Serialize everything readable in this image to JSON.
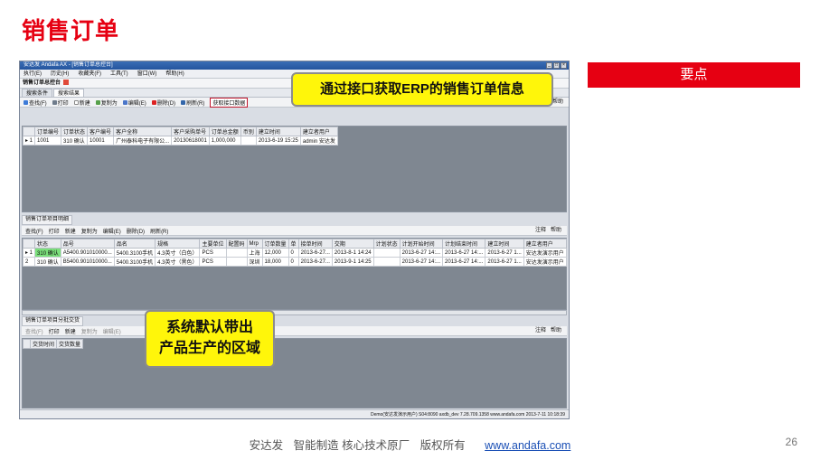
{
  "slide": {
    "title": "销售订单",
    "keypoint": "要点",
    "callout_top": "通过接口获取ERP的销售订单信息",
    "callout_bottom_line1": "系统默认带出",
    "callout_bottom_line2": "产品生产的区域",
    "footer": {
      "company": "安达发",
      "slogan": "智能制造 核心技术原厂",
      "rights": "版权所有",
      "url": "www.andafa.com"
    },
    "page_number": "26"
  },
  "app": {
    "window_title": "安达发 Andafa AX - [销售订单总控台]",
    "menu": [
      "执行(E)",
      "历史(H)",
      "收藏夹(F)",
      "工具(T)",
      "窗口(W)",
      "帮助(H)"
    ],
    "form_tab": "销售订单总控台",
    "subtabs": [
      "搜索条件",
      "搜索结果"
    ],
    "toolbar_top": [
      "查找(F)",
      "打印",
      "新建",
      "复制为",
      "编辑(E)",
      "删除(D)",
      "刷新(R)",
      "获取接口数据"
    ],
    "toolbar_right": [
      "注释",
      "帮助"
    ],
    "orders": {
      "columns": [
        "订单编号",
        "订单状态",
        "客户编号",
        "客户全称",
        "客户采购单号",
        "订单总金额",
        "币别",
        "建立时间",
        "建立者用户"
      ],
      "rows": [
        [
          "1001",
          "310 确认",
          "10001",
          "广州泰科电子有限公...",
          "20130618001",
          "1,000,000",
          "",
          "2013-6-19 15:25",
          "admin 安达发"
        ]
      ]
    },
    "detail_label": "销售订单项目明细",
    "toolbar_mid": [
      "查找(F)",
      "打印",
      "新建",
      "复制为",
      "编辑(E)",
      "删除(D)",
      "刷新(R)"
    ],
    "details": {
      "columns": [
        "状态",
        "品号",
        "品名",
        "规格",
        "主要单位",
        "配置码",
        "Mrp",
        "订单数量",
        "单",
        "接单时间",
        "交期",
        "计划状态",
        "计划开始时间",
        "计划结束时间",
        "建立时间",
        "建立者用户"
      ],
      "rows": [
        [
          "310 确认",
          "A5400.901010000...",
          "5400.3100手机",
          "4.3英寸（白色）",
          "PCS",
          "",
          "上海",
          "12,000",
          "0",
          "2013-6-27...",
          "2013-8-1 14:24",
          "",
          "2013-6-27 14:...",
          "2013-6-27 14:...",
          "2013-6-27 1...",
          "安达发演示用户"
        ],
        [
          "310 确认",
          "B5400.901010000...",
          "5400.3100手机",
          "4.3英寸（黑色）",
          "PCS",
          "",
          "深圳",
          "18,000",
          "0",
          "2013-6-27...",
          "2013-9-1 14:25",
          "",
          "2013-6-27 14:...",
          "2013-6-27 14:...",
          "2013-6-27 1...",
          "安达发演示用户"
        ]
      ]
    },
    "split_label": "销售订单项目分批交货",
    "toolbar_bottom": [
      "查找(F)",
      "打印",
      "新建",
      "复制为",
      "编辑(E)"
    ],
    "split": {
      "columns": [
        "交货时间",
        "交货数量"
      ]
    },
    "statusbar": "Demo(安达发演示用户)   S04:8090   axdb_dev   7.28.709.1358   www.andafa.com   2013-7-11 10:18:39"
  }
}
